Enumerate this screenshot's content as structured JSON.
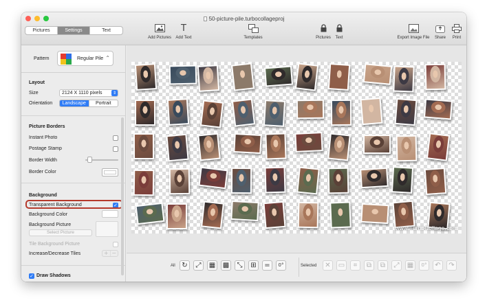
{
  "window": {
    "title": "50-picture-pile.turbocollageproj"
  },
  "tabs": [
    {
      "label": "Pictures",
      "active": false
    },
    {
      "label": "Settings",
      "active": true
    },
    {
      "label": "Text",
      "active": false
    }
  ],
  "toolbar": {
    "add_pictures": "Add Pictures",
    "add_text": "Add Text",
    "templates": "Templates",
    "pictures_lock": "Pictures",
    "text_lock": "Text",
    "export": "Export Image File",
    "share": "Share",
    "print": "Print"
  },
  "sidebar": {
    "pattern_label": "Pattern",
    "pattern_value": "Regular Pile",
    "layout": {
      "title": "Layout",
      "size_label": "Size",
      "size_value": "2124 X 1110 pixels",
      "orientation_label": "Orientation",
      "orientation_options": [
        "Landscape",
        "Portrait"
      ],
      "orientation_selected": "Landscape"
    },
    "borders": {
      "title": "Picture Borders",
      "instant_photo": "Instant Photo",
      "postage_stamp": "Postage Stamp",
      "border_width": "Border Width",
      "border_color": "Border Color"
    },
    "background": {
      "title": "Background",
      "transparent": "Transparent Background",
      "transparent_checked": true,
      "color": "Background Color",
      "picture": "Background Picture",
      "select_picture": "Select Picture",
      "tile": "Tile Background Picture",
      "increase_decrease": "Increase/Decrease Tiles"
    },
    "shadows": {
      "label": "Draw Shadows",
      "checked": true
    }
  },
  "canvas": {
    "watermark": "www.TurboCollage.com"
  },
  "bottombar": {
    "all_label": "All",
    "selected_label": "Selected"
  },
  "colors": {
    "accent": "#2f7cf6",
    "highlight": "#b5392b"
  }
}
